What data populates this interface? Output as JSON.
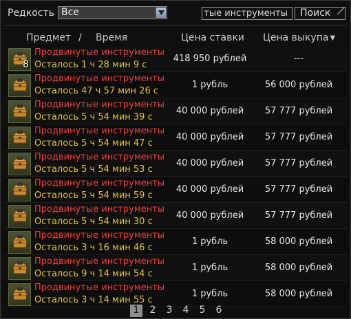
{
  "filters": {
    "rarity_label": "Редкость",
    "rarity_value": "Все",
    "search_value": "тые инструменты",
    "search_button": "Поиск"
  },
  "header": {
    "item": "Предмет",
    "slash": "/",
    "time": "Время",
    "bid": "Цена ставки",
    "buyout": "Цена выкупа",
    "sort_icon": "sort-down-icon"
  },
  "rows": [
    {
      "name": "Продвинутые инструменты",
      "time": "Осталось 1 ч 28 мин 9 с",
      "bid": "418 950 рублей",
      "buyout": "---",
      "qty": "8",
      "icon": "toolbox-icon"
    },
    {
      "name": "Продвинутые инструменты",
      "time": "Осталось 47 ч 57 мин 26 с",
      "bid": "1 рубль",
      "buyout": "56 000 рублей",
      "qty": "",
      "icon": "toolbox-icon"
    },
    {
      "name": "Продвинутые инструменты",
      "time": "Осталось 5 ч 54 мин 39 с",
      "bid": "40 000 рублей",
      "buyout": "57 777 рублей",
      "qty": "",
      "icon": "toolbox-icon"
    },
    {
      "name": "Продвинутые инструменты",
      "time": "Осталось 5 ч 54 мин 47 с",
      "bid": "40 000 рублей",
      "buyout": "57 777 рублей",
      "qty": "",
      "icon": "toolbox-icon"
    },
    {
      "name": "Продвинутые инструменты",
      "time": "Осталось 5 ч 54 мин 53 с",
      "bid": "40 000 рублей",
      "buyout": "57 777 рублей",
      "qty": "",
      "icon": "toolbox-icon"
    },
    {
      "name": "Продвинутые инструменты",
      "time": "Осталось 5 ч 54 мин 59 с",
      "bid": "40 000 рублей",
      "buyout": "57 777 рублей",
      "qty": "",
      "icon": "toolbox-icon"
    },
    {
      "name": "Продвинутые инструменты",
      "time": "Осталось 5 ч 54 мин 30 с",
      "bid": "40 000 рублей",
      "buyout": "57 777 рублей",
      "qty": "",
      "icon": "toolbox-icon"
    },
    {
      "name": "Продвинутые инструменты",
      "time": "Осталось 3 ч 16 мин 46 с",
      "bid": "1 рубль",
      "buyout": "58 000 рублей",
      "qty": "",
      "icon": "toolbox-icon"
    },
    {
      "name": "Продвинутые инструменты",
      "time": "Осталось 9 ч 14 мин 54 с",
      "bid": "1 рубль",
      "buyout": "58 000 рублей",
      "qty": "",
      "icon": "toolbox-icon"
    },
    {
      "name": "Продвинутые инструменты",
      "time": "Осталось 3 ч 14 мин 55 с",
      "bid": "1 рубль",
      "buyout": "58 000 рублей",
      "qty": "",
      "icon": "toolbox-icon"
    }
  ],
  "pagination": {
    "pages": [
      "1",
      "2",
      "3",
      "4",
      "5",
      "6"
    ],
    "current": "1"
  },
  "colors": {
    "item_name": "#ef3e3e",
    "time_left": "#e1c23a",
    "icon_bg": "#4a5236"
  }
}
